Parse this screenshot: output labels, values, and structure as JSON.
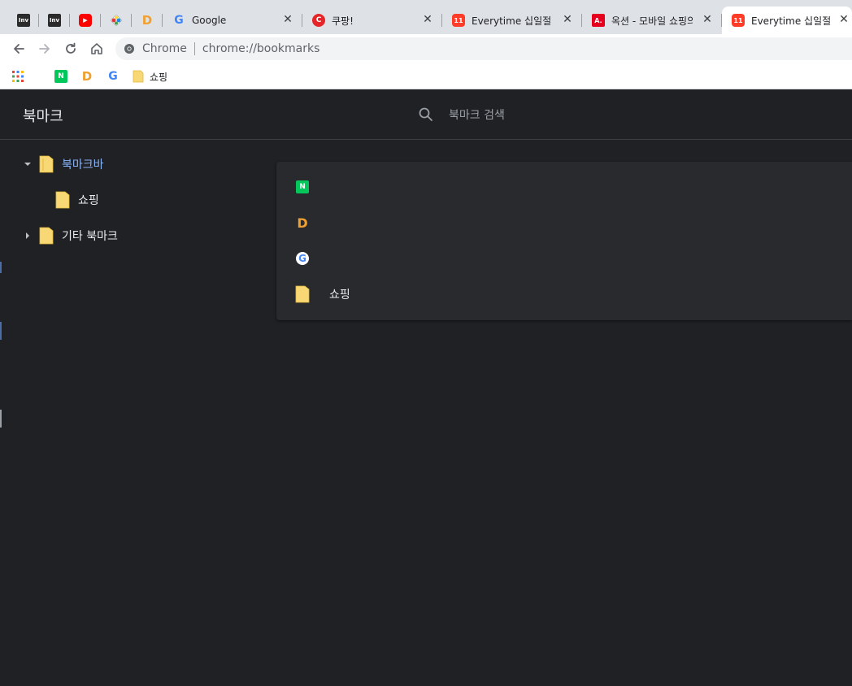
{
  "tabs": [
    {
      "title": "",
      "favicon": "inven-icon",
      "fav_text": "Inv"
    },
    {
      "title": "",
      "favicon": "inven-icon",
      "fav_text": "Inv"
    },
    {
      "title": "",
      "favicon": "youtube-icon",
      "fav_text": "▶"
    },
    {
      "title": "",
      "favicon": "multicolor-app-icon",
      "fav_text": ""
    },
    {
      "title": "",
      "favicon": "daum-icon",
      "fav_text": "D"
    },
    {
      "title": "Google",
      "favicon": "google-icon",
      "fav_text": "G"
    },
    {
      "title": "쿠팡!",
      "favicon": "coupang-icon",
      "fav_text": "C"
    },
    {
      "title": "Everytime 십일절 - ",
      "favicon": "11st-icon",
      "fav_text": "11"
    },
    {
      "title": "옥션 - 모바일 쇼핑의",
      "favicon": "auction-icon",
      "fav_text": "A."
    },
    {
      "title": "Everytime 십일절 - ",
      "favicon": "11st-icon",
      "fav_text": "11"
    }
  ],
  "toolbar": {
    "origin_label": "Chrome",
    "url": "chrome://bookmarks"
  },
  "bookmarks_bar": {
    "items": [
      {
        "favicon": "naver-icon",
        "fav_text": "N",
        "label": ""
      },
      {
        "favicon": "daum-icon",
        "fav_text": "D",
        "label": ""
      },
      {
        "favicon": "google-icon",
        "fav_text": "G",
        "label": ""
      },
      {
        "favicon": "folder-icon",
        "fav_text": "",
        "label": "쇼핑"
      }
    ]
  },
  "page": {
    "title": "북마크",
    "search_placeholder": "북마크 검색"
  },
  "tree": [
    {
      "label": "북마크바",
      "expanded": true,
      "selected": true,
      "level": 0
    },
    {
      "label": "쇼핑",
      "expanded": false,
      "selected": false,
      "level": 1
    },
    {
      "label": "기타 북마크",
      "expanded": false,
      "selected": false,
      "level": 0
    }
  ],
  "list": [
    {
      "favicon": "naver-icon",
      "fav_text": "N",
      "label": ""
    },
    {
      "favicon": "daum-icon",
      "fav_text": "D",
      "label": ""
    },
    {
      "favicon": "google-icon",
      "fav_text": "G",
      "label": ""
    },
    {
      "favicon": "folder-icon",
      "fav_text": "",
      "label": "쇼핑"
    }
  ],
  "colors": {
    "page_background": "#202124",
    "card_background": "#292a2d",
    "selected_text": "#8ab4f8",
    "folder": "#f8d775",
    "naver_green": "#03c75a",
    "youtube_red": "#ff0000",
    "coupang_red": "#e52528",
    "elevenst_red": "#ff3c28",
    "auction_red": "#e5001e"
  }
}
